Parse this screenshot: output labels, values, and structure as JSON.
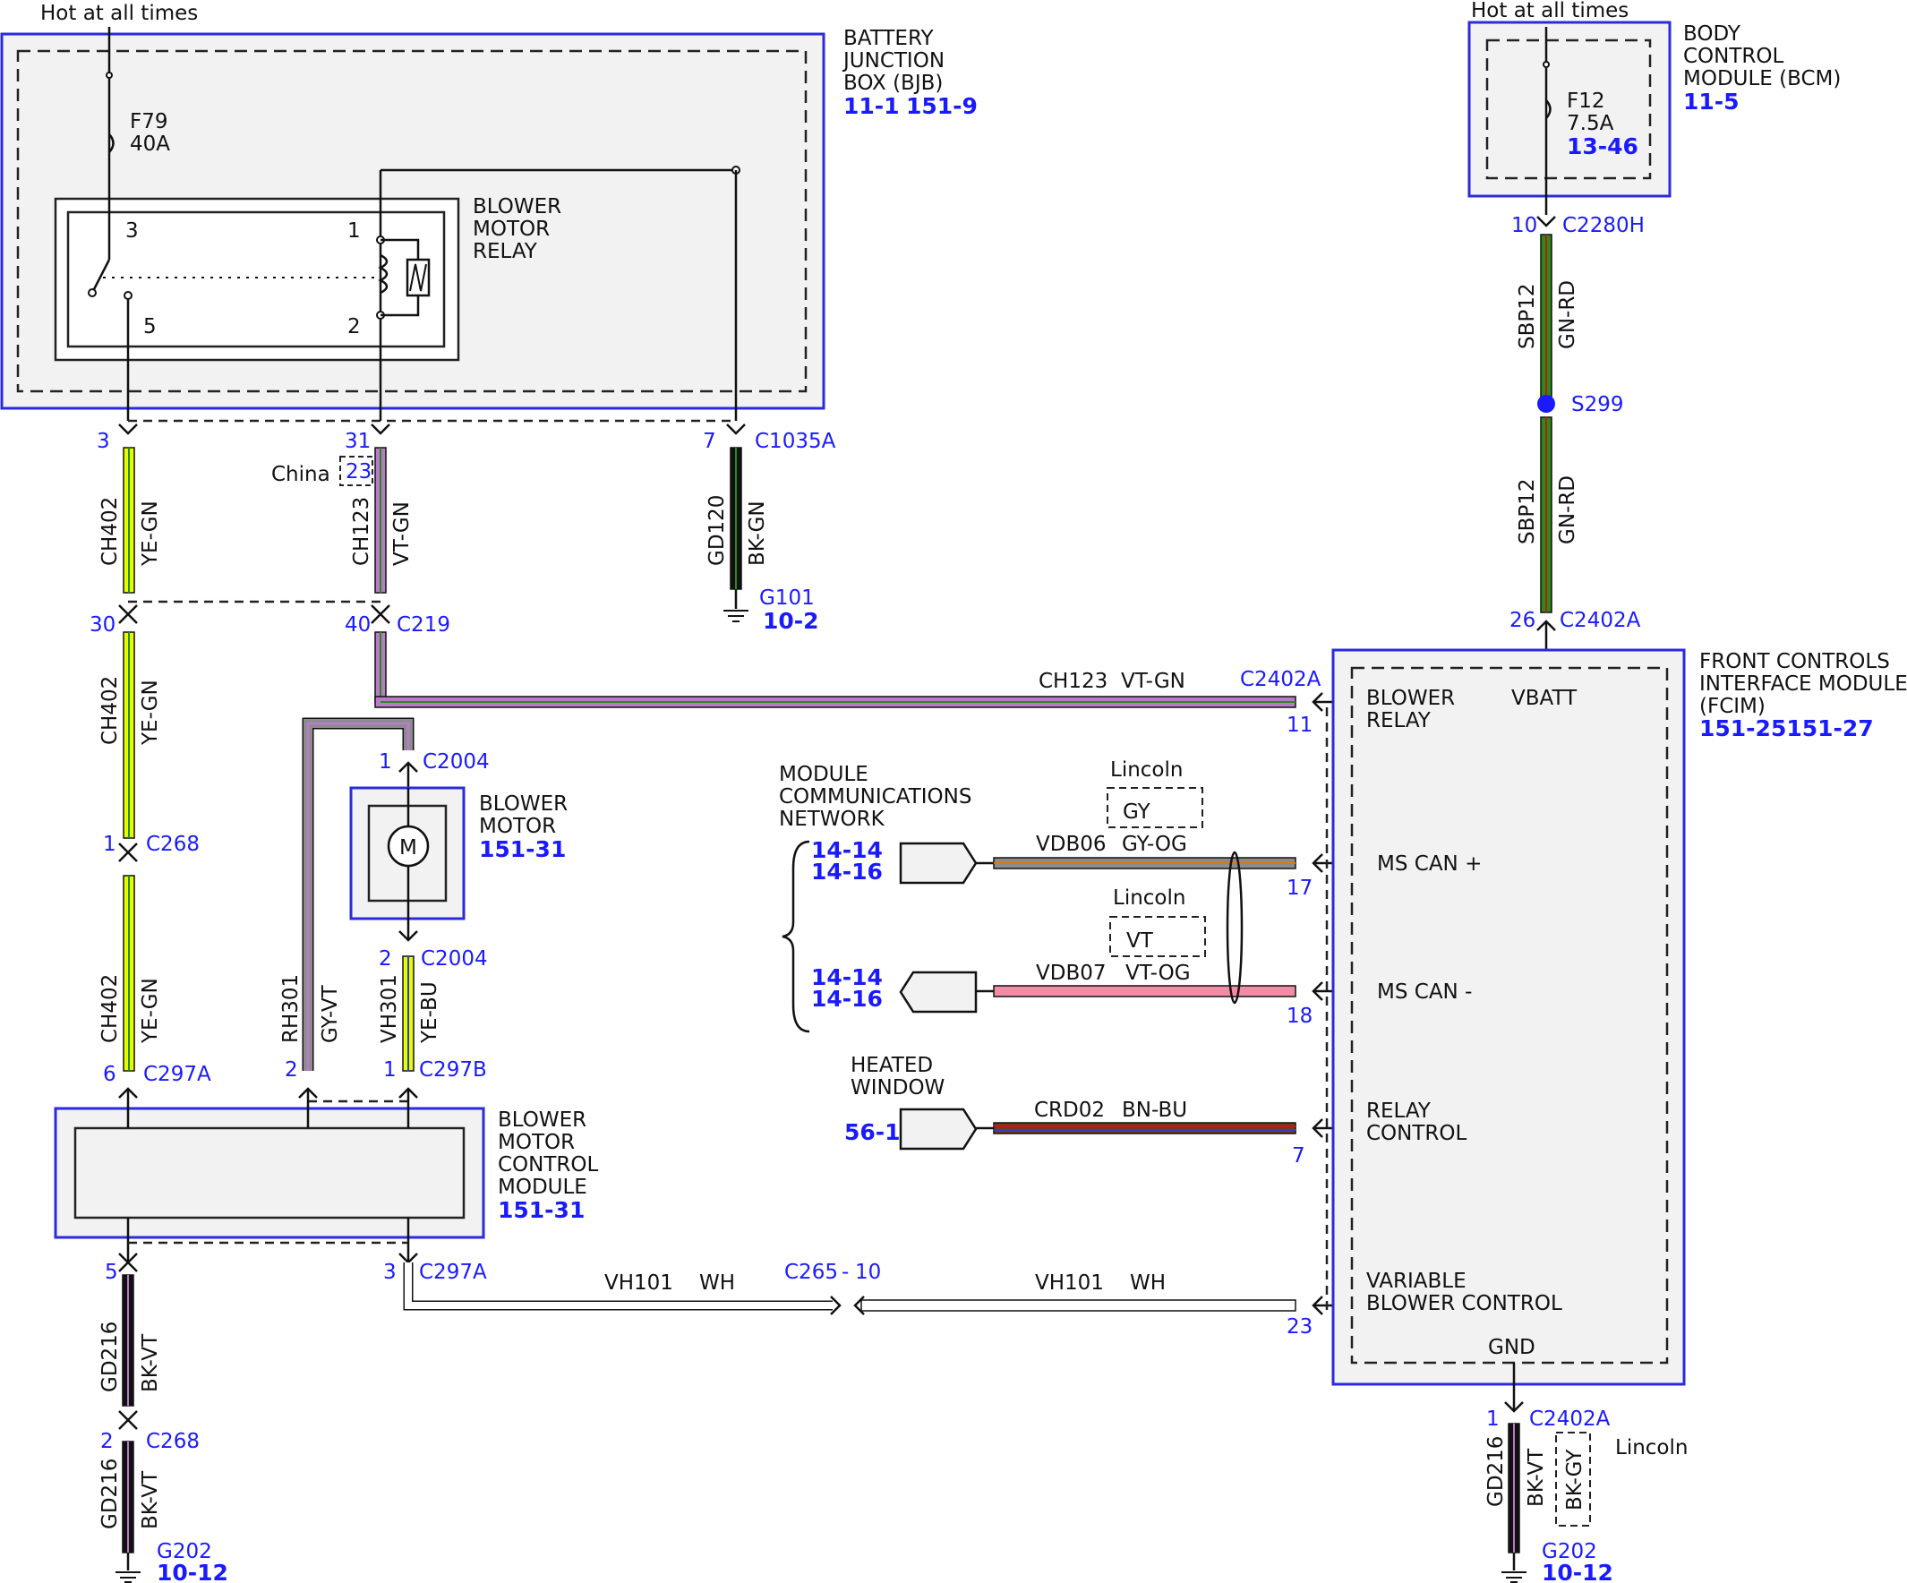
{
  "colors": {
    "module_outline": "#2b2bdd",
    "module_fill": "#f2f2f2",
    "pin_text": "#1a1aff",
    "splice": "#1a1aff",
    "YE": "#e6ff00",
    "GN": "#2a8a1a",
    "VT": "#b77bc8",
    "BK": "#111111",
    "GY": "#8c8c8c",
    "OG": "#e07b00",
    "PK": "#f28ca6",
    "RD": "#c01818",
    "BU": "#2a3fd0",
    "WH": "#ffffff"
  },
  "bjb": {
    "hot_label": "Hot at all times",
    "title_1": "BATTERY",
    "title_2": "JUNCTION",
    "title_3": "BOX (BJB)",
    "ref_1": "11-1",
    "ref_2": "151-9",
    "fuse_name": "F79",
    "fuse_rating": "40A",
    "relay_title_1": "BLOWER",
    "relay_title_2": "MOTOR",
    "relay_title_3": "RELAY",
    "relay_pin_3": "3",
    "relay_pin_1": "1",
    "relay_pin_5": "5",
    "relay_pin_2": "2"
  },
  "bcm": {
    "hot_label": "Hot at all times",
    "title_1": "BODY",
    "title_2": "CONTROL",
    "title_3": "MODULE (BCM)",
    "ref": "11-5",
    "fuse_name": "F12",
    "fuse_rating": "7.5A",
    "fuse_ref": "13-46",
    "pin": "10",
    "connector": "C2280H"
  },
  "circuits": {
    "ch402_top": {
      "pin_top": "3",
      "pin_bottom": "30",
      "circuit": "CH402",
      "color": "YE-GN",
      "connector_bottom": "C219"
    },
    "ch402_mid": {
      "circuit": "CH402",
      "color": "YE-GN",
      "pin": "1",
      "connector": "C268"
    },
    "ch402_low": {
      "circuit": "CH402",
      "color": "YE-GN",
      "pin": "6",
      "connector": "C297A"
    },
    "ch123": {
      "pin_top": "31",
      "china_pin": "23",
      "china_label": "China",
      "circuit": "CH123",
      "color": "VT-GN",
      "pin_bottom": "40",
      "connector_bottom": "C219"
    },
    "ch123_h": {
      "circuit": "CH123",
      "color": "VT-GN",
      "connector": "C2402A",
      "pin": "11"
    },
    "gd120": {
      "pin": "7",
      "connector": "C1035A",
      "circuit": "GD120",
      "color": "BK-GN",
      "ground": "G101",
      "ground_ref": "10-2"
    },
    "sbp12_top": {
      "circuit": "SBP12",
      "color": "GN-RD"
    },
    "splice": {
      "name": "S299"
    },
    "sbp12_low": {
      "circuit": "SBP12",
      "color": "GN-RD",
      "pin": "26",
      "connector": "C2402A"
    },
    "rh301": {
      "circuit": "RH301",
      "color": "GY-VT",
      "pin_top": "1",
      "connector_top": "C2004",
      "pin_bottom": "2"
    },
    "vh301": {
      "circuit": "VH301",
      "color": "YE-BU",
      "pin_top": "2",
      "connector_top": "C2004",
      "pin_bottom": "1",
      "connector_bottom": "C297B"
    },
    "gd216_top": {
      "pin": "5",
      "circuit": "GD216",
      "color": "BK-VT",
      "pin_bottom": "2",
      "connector_bottom": "C268"
    },
    "gd216_low": {
      "circuit": "GD216",
      "color": "BK-VT",
      "ground": "G202",
      "ground_ref": "10-12"
    },
    "vh101": {
      "pin": "3",
      "connector": "C297A",
      "circuit_1": "VH101",
      "color_1": "WH",
      "inline": "C265",
      "inline_sep": "-",
      "inline_pin": "10",
      "circuit_2": "VH101",
      "color_2": "WH",
      "fcim_pin": "23"
    },
    "vdb06": {
      "circuit": "VDB06",
      "color": "GY-OG",
      "fcim_pin": "17",
      "alt_label": "Lincoln",
      "alt_color": "GY"
    },
    "vdb07": {
      "circuit": "VDB07",
      "color": "VT-OG",
      "fcim_pin": "18",
      "alt_label": "Lincoln",
      "alt_color": "VT"
    },
    "crd02": {
      "circuit": "CRD02",
      "color": "BN-BU",
      "fcim_pin": "7"
    },
    "gd216_fcim": {
      "pin": "1",
      "connector": "C2402A",
      "circuit": "GD216",
      "color": "BK-VT",
      "alt_color": "BK-GY",
      "alt_label": "Lincoln",
      "ground": "G202",
      "ground_ref": "10-12"
    }
  },
  "blower_motor": {
    "title_1": "BLOWER",
    "title_2": "MOTOR",
    "ref": "151-31",
    "symbol": "M"
  },
  "bmcm": {
    "title_1": "BLOWER",
    "title_2": "MOTOR",
    "title_3": "CONTROL",
    "title_4": "MODULE",
    "ref": "151-31"
  },
  "network": {
    "title_1": "MODULE",
    "title_2": "COMMUNICATIONS",
    "title_3": "NETWORK",
    "ref_a1": "14-14",
    "ref_a2": "14-16",
    "ref_b1": "14-14",
    "ref_b2": "14-16"
  },
  "heated_window": {
    "title_1": "HEATED",
    "title_2": "WINDOW",
    "ref": "56-1"
  },
  "fcim": {
    "title_1": "FRONT CONTROLS",
    "title_2": "INTERFACE MODULE",
    "title_3": "(FCIM)",
    "ref": "151-25151-27",
    "blower_relay_1": "BLOWER",
    "blower_relay_2": "RELAY",
    "vbatt": "VBATT",
    "ms_can_plus": "MS CAN +",
    "ms_can_minus": "MS CAN -",
    "relay_control_1": "RELAY",
    "relay_control_2": "CONTROL",
    "variable_1": "VARIABLE",
    "variable_2": "BLOWER CONTROL",
    "gnd": "GND"
  }
}
